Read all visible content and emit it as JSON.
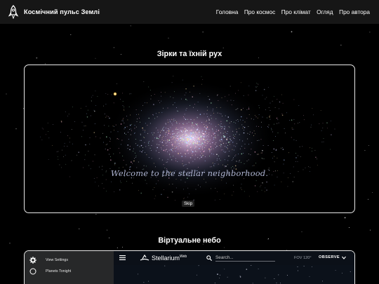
{
  "header": {
    "logo_icon": "rocket-icon",
    "title": "Космічний пульс Землі",
    "nav": [
      {
        "label": "Головна"
      },
      {
        "label": "Про космос"
      },
      {
        "label": "Про клімат"
      },
      {
        "label": "Огляд"
      },
      {
        "label": "Про автора"
      }
    ]
  },
  "section_stars": {
    "title": "Зірки та їхній рух",
    "welcome": "Welcome to the stellar neighborhood.",
    "skip_label": "Skip"
  },
  "section_sky": {
    "title": "Віртуальне небо",
    "sidebar": [
      {
        "label": "View Settings",
        "icon": "gear-icon"
      },
      {
        "label": "Planets Tonight",
        "icon": "circle-icon"
      }
    ],
    "brand": "Stellarium",
    "brand_sup": "Web",
    "search_placeholder": "Search...",
    "fov": "FOV 120°",
    "mode": "OBSERVE"
  },
  "colors": {
    "page_bg": "#000000",
    "navbar_bg": "#161616",
    "frame_border": "#e8e8e8",
    "welcome_text": "#aeb4d2",
    "stellarium_sidebar": "#272829",
    "stellarium_sky": "#0b111a"
  }
}
